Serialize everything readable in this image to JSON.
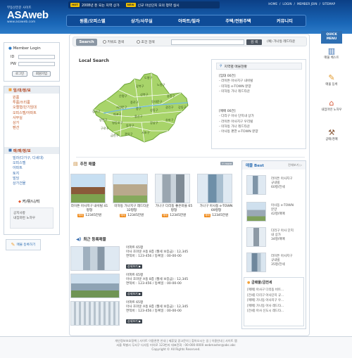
{
  "site": {
    "logo_sub": "부동산전문 사이트",
    "logo_name": "ASAweb",
    "logo_url": "www.asaweb.com"
  },
  "notice_bar": {
    "hot_badge": "HOT",
    "hot_text": "2008년 돈 되는 지역 상가",
    "new_badge": "NEW",
    "new_text": "신규 아산단지 모의 청약 실시"
  },
  "toplinks": [
    "HOME",
    "/",
    "LOGIN",
    "/",
    "MEMBER JOIN",
    "/",
    "SITEMAP"
  ],
  "gnb": [
    "원룸/오피스텔",
    "상가/사무실",
    "아파트/빌라",
    "주택/전원주택",
    "커뮤니티"
  ],
  "login": {
    "title": "Member Login",
    "id_label": "ID",
    "pw_label": "PW",
    "login_btn": "로그인",
    "join_btn": "회원가입"
  },
  "category1": {
    "title": "임/대/정/보",
    "items": [
      "원룸",
      "투룸/쓰리룸",
      "오렐형/단기임대",
      "오피스텔/아파트",
      "사무실",
      "상가",
      "펜션"
    ]
  },
  "category2": {
    "title": "매/매/정/보",
    "items": [
      "빌라(다가구, 다세대)",
      "오피스텔",
      "아파트",
      "토지",
      "빌딩",
      "상가건물"
    ]
  },
  "community": {
    "title": "커/뮤/니/티",
    "items": [
      "공지사항",
      "내집마련 노하우"
    ]
  },
  "banner_left": "매물 등록하기",
  "search": {
    "button": "Search",
    "radio1": "키워드 검색",
    "radio2": "조건 검색",
    "go": "검 색",
    "keyword": "(예) 가나동 레드타운"
  },
  "local_search": {
    "title": "Local Search",
    "districts": [
      "도봉구",
      "노원구",
      "강북구",
      "은평구",
      "성북구",
      "중랑구",
      "종로구",
      "동대문구",
      "서대문구",
      "중구",
      "성동구",
      "광진구",
      "마포구",
      "용산구",
      "강서구",
      "양천구",
      "영등포구",
      "동작구",
      "강동구",
      "송파구",
      "강남구",
      "서초구",
      "구로구",
      "금천구",
      "관악구"
    ]
  },
  "region_panel": {
    "title": "지역별 매물현황",
    "group1_title": "[임대 00건]",
    "group1": [
      "- 라이튼 아사지구 내쉬빌",
      "- 미하동 e-TOWN 분양",
      "- 미하동 가나 레드타운"
    ],
    "group2_title": "[매매 00건]",
    "group2": [
      "- 다리구 아사 단지내 상가",
      "- 라이튼 아사지구 우리빌",
      "- 미하동 가나 레드타운",
      "- 아사동 편한 e-TOWN 분양"
    ]
  },
  "recommend": {
    "title": "추천 매물",
    "more": "+ more",
    "cards": [
      {
        "caption": "라이튼 아사지구 내쉬빌 41평형",
        "badge": "매매",
        "price": "12345만원"
      },
      {
        "caption": "미하동 가나지구 레드타운 32평형",
        "badge": "매매",
        "price": "12345만원"
      },
      {
        "caption": "가나구 다리동 좋은마을 65평형",
        "badge": "매매",
        "price": "12345만원"
      },
      {
        "caption": "가나구 아사동 e-TOWN 69평형",
        "badge": "매매",
        "price": "12345만원"
      }
    ]
  },
  "recent": {
    "title": "최근 등록매물",
    "items": [
      {
        "l1": "아파트 65평",
        "l2": "아사 호마운 A동 8층 (월세 보증금) : 12,345",
        "l3": "면적비 : 123-456   /   등록일 : 00-00-00",
        "btn": "상세보기 ▶"
      },
      {
        "l1": "아파트 65평",
        "l2": "아사 호마운 A동 8층 (월세 보증금) : 12,345",
        "l3": "면적비 : 123-456   /   등록일 : 00-00-00",
        "btn": "상세보기 ▶"
      },
      {
        "l1": "아파트 65평",
        "l2": "아사 호마운 A동 8층 (월세 보증금) : 12,345",
        "l3": "면적비 : 123-456   /   등록일 : 00-00-00",
        "btn": "상세보기 ▶"
      }
    ]
  },
  "best": {
    "title": "매물 Best",
    "more": "전체보기 ▷",
    "items": [
      {
        "l1": "라이튼 아사지구",
        "l2": "규내빌",
        "l3": "60평/전세"
      },
      {
        "l1": "아사동 e-TOWN",
        "l2": "분양",
        "l3": "42평/매매"
      },
      {
        "l1": "다리구 아사 단지",
        "l2": "내 상가",
        "l3": "34평/매매"
      },
      {
        "l1": "라이튼 아사지구",
        "l2": "규내빌",
        "l3": "35평/전세"
      }
    ]
  },
  "notice_box": {
    "title": "금매물/금전세",
    "items": [
      "[매매] 아사구 다리동 비트...",
      "[전세] 다리구 아사단지 규...",
      "[매매] 가나동 아사지구 우...",
      "[매매] 가나동 아사 레드타...",
      "[전세] 아사 신도시 레드타..."
    ]
  },
  "quick": {
    "title": "QUICK MENU",
    "items": [
      "매물 베스트",
      "매물 등록",
      "내집마련 노하우",
      "공매/경매"
    ]
  },
  "footer": {
    "links": "개인정보보호정책  |  사이트 이용관련 안내  |  제휴및 광고문의  |  찾아오시는 길  |  이용안내  |  사이트 맵",
    "addr": "서울 특별시 무서구 다사동 미의로 123번지  대표전화 : 00-000-0000  webmaster@abc.abc",
    "copy": "Copyright © All Rights Reserved."
  },
  "colors": {
    "header_top": "#0b3f86",
    "header_bottom": "#2e7cc8",
    "map_green": "#a8d46a",
    "accent_orange": "#f08c1d",
    "cat_red": "#b3421b"
  }
}
